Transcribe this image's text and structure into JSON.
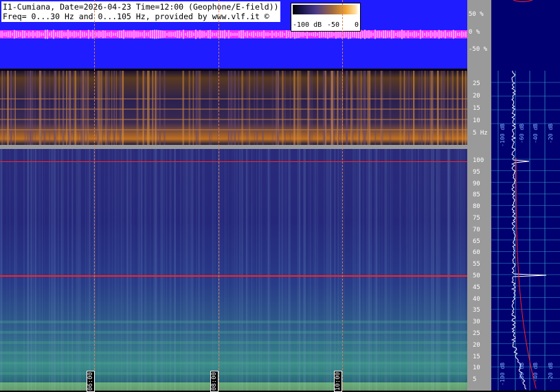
{
  "header": {
    "line1": "I1-Cumiana, Date=2026-04-23 Time=12:00 (Geophone/E-field))",
    "line2": "Freq= 0...30 Hz and 0...105 Hz, provided by www.vlf.it ©"
  },
  "colorbar": {
    "labels": [
      "-100 dB",
      "-50",
      "0"
    ]
  },
  "waveform_scale": [
    "50 %",
    "0 %",
    "-50 %"
  ],
  "spec30_ticks": [
    "25",
    "20",
    "15",
    "10",
    "5 Hz"
  ],
  "spec105_ticks": [
    "100",
    "95",
    "90",
    "85",
    "80",
    "75",
    "70",
    "65",
    "60",
    "55",
    "50",
    "45",
    "40",
    "35",
    "30",
    "25",
    "20",
    "15",
    "10",
    "5"
  ],
  "time_markers": [
    "06:00",
    "08:00",
    "10:00"
  ],
  "right_panel": {
    "top_labels": [
      "-100 dB",
      "-60 dB",
      "-40 dB",
      "-20 dB"
    ],
    "bottom_labels": [
      "-100 dB",
      "-60 dB",
      "-40 dB",
      "-20 dB"
    ]
  },
  "colors": {
    "waveform_bg": "#1f1cff",
    "waveform_trace": "#ff30ff",
    "scale_bg": "#9a9a9a",
    "spectrum_panel_bg": "#000070",
    "line_50hz": "#ff2020"
  }
}
